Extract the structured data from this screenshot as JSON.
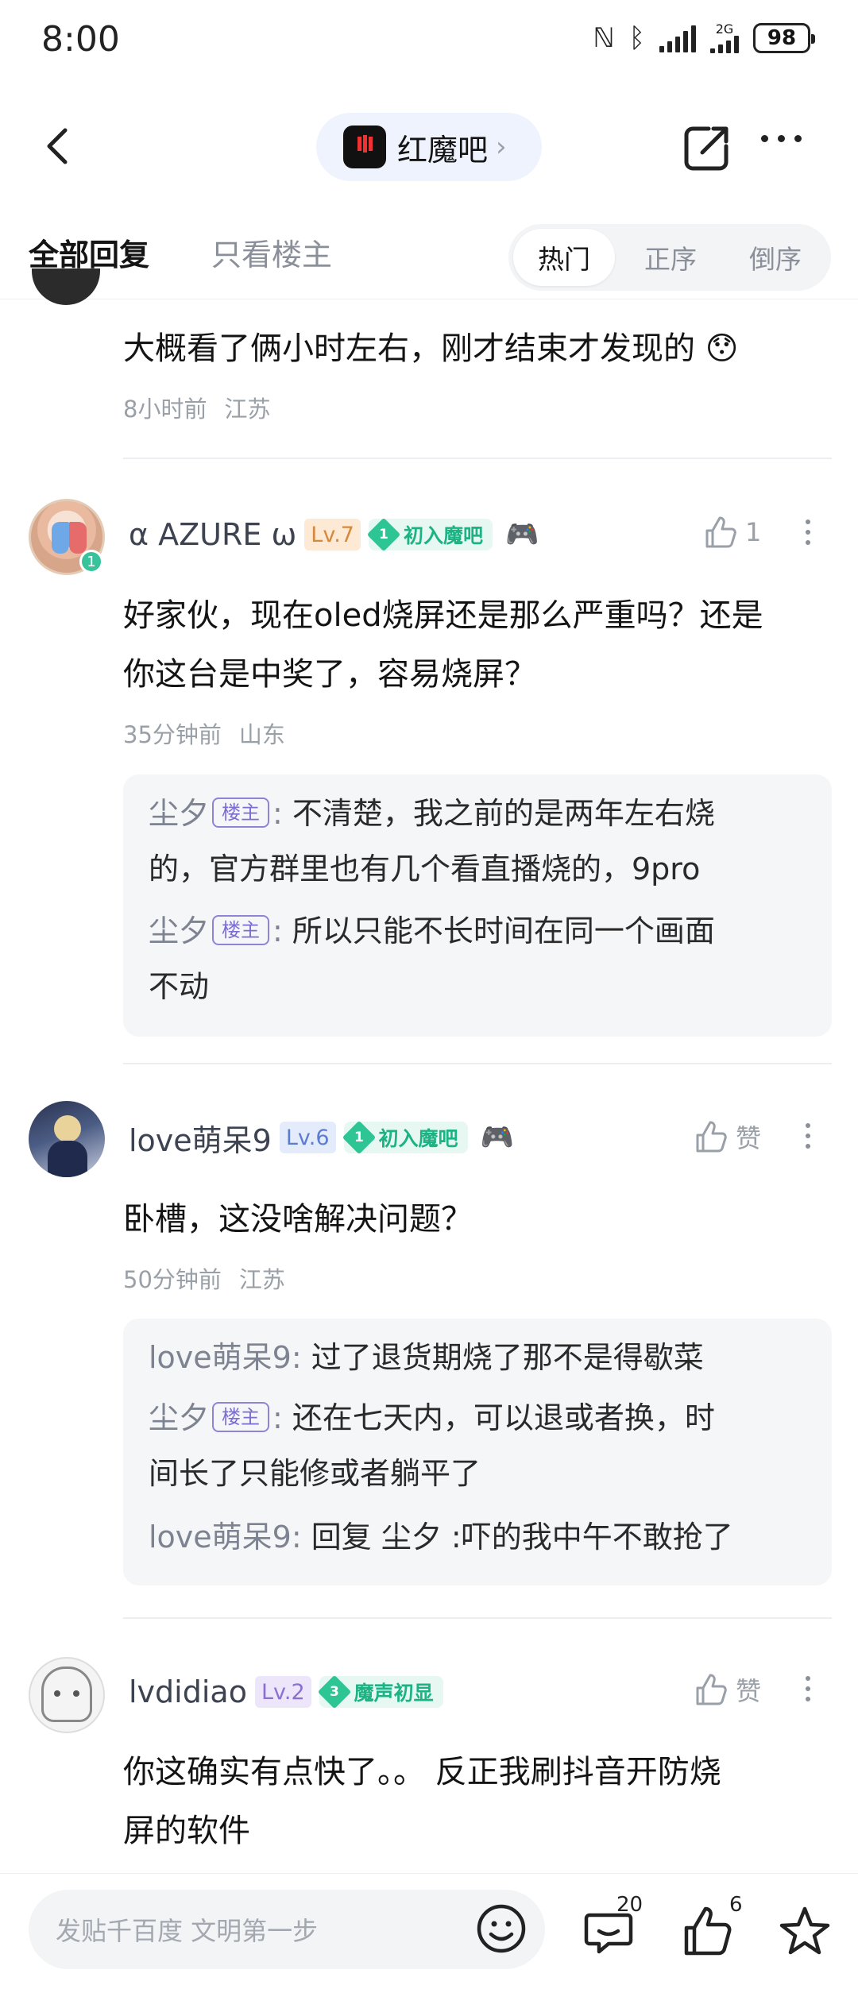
{
  "status_bar": {
    "time": "8:00",
    "network": "2G",
    "battery": "98"
  },
  "navbar": {
    "forum_name": "红魔吧",
    "forum_logo_text": "红魔"
  },
  "tabs": {
    "all_replies": "全部回复",
    "only_op": "只看楼主",
    "sort_hot": "热门",
    "sort_asc": "正序",
    "sort_desc": "倒序"
  },
  "comments": [
    {
      "text": "大概看了俩小时左右，刚才结束才发现的 😯",
      "time": "8小时前",
      "location": "江苏"
    },
    {
      "username": "α AZURE ω",
      "level": "Lv.7",
      "title_num": "1",
      "title": "初入魔吧",
      "avatar_badge": "1",
      "likes": "1",
      "lines": [
        "好家伙，现在oled烧屏还是那么严重吗？还是",
        "你这台是中奖了，容易烧屏？"
      ],
      "time": "35分钟前",
      "location": "山东",
      "replies": [
        {
          "name": "尘夕",
          "tag": "楼主",
          "sep": ":",
          "lines": [
            "不清楚，我之前的是两年左右烧",
            "的，官方群里也有几个看直播烧的，9pro"
          ]
        },
        {
          "name": "尘夕",
          "tag": "楼主",
          "sep": ":",
          "lines": [
            "所以只能不长时间在同一个画面",
            "不动"
          ]
        }
      ]
    },
    {
      "username": "love萌呆9",
      "level": "Lv.6",
      "title_num": "1",
      "title": "初入魔吧",
      "likes": "赞",
      "lines": [
        "卧槽，这没啥解决问题？"
      ],
      "time": "50分钟前",
      "location": "江苏",
      "replies": [
        {
          "name": "love萌呆9",
          "sep": ":",
          "lines": [
            "过了退货期烧了那不是得歇菜"
          ]
        },
        {
          "name": "尘夕",
          "tag": "楼主",
          "sep": ":",
          "lines": [
            "还在七天内，可以退或者换，时",
            "间长了只能修或者躺平了"
          ]
        },
        {
          "name": "love萌呆9",
          "sep": ":",
          "lines": [
            "回复 尘夕 :吓的我中午不敢抢了"
          ]
        }
      ]
    },
    {
      "username": "lvdidiao",
      "level": "Lv.2",
      "title_num": "3",
      "title": "魔声初显",
      "likes": "赞",
      "lines": [
        "你这确实有点快了。。 反正我刷抖音开防烧",
        "屏的软件"
      ]
    }
  ],
  "bottom_bar": {
    "placeholder": "发贴千百度 文明第一步",
    "comment_count": "20",
    "like_count": "6"
  },
  "colors": {
    "accent_green": "#2ec594",
    "op_tag": "#8e84d6",
    "level_orange": "#d6893a"
  }
}
